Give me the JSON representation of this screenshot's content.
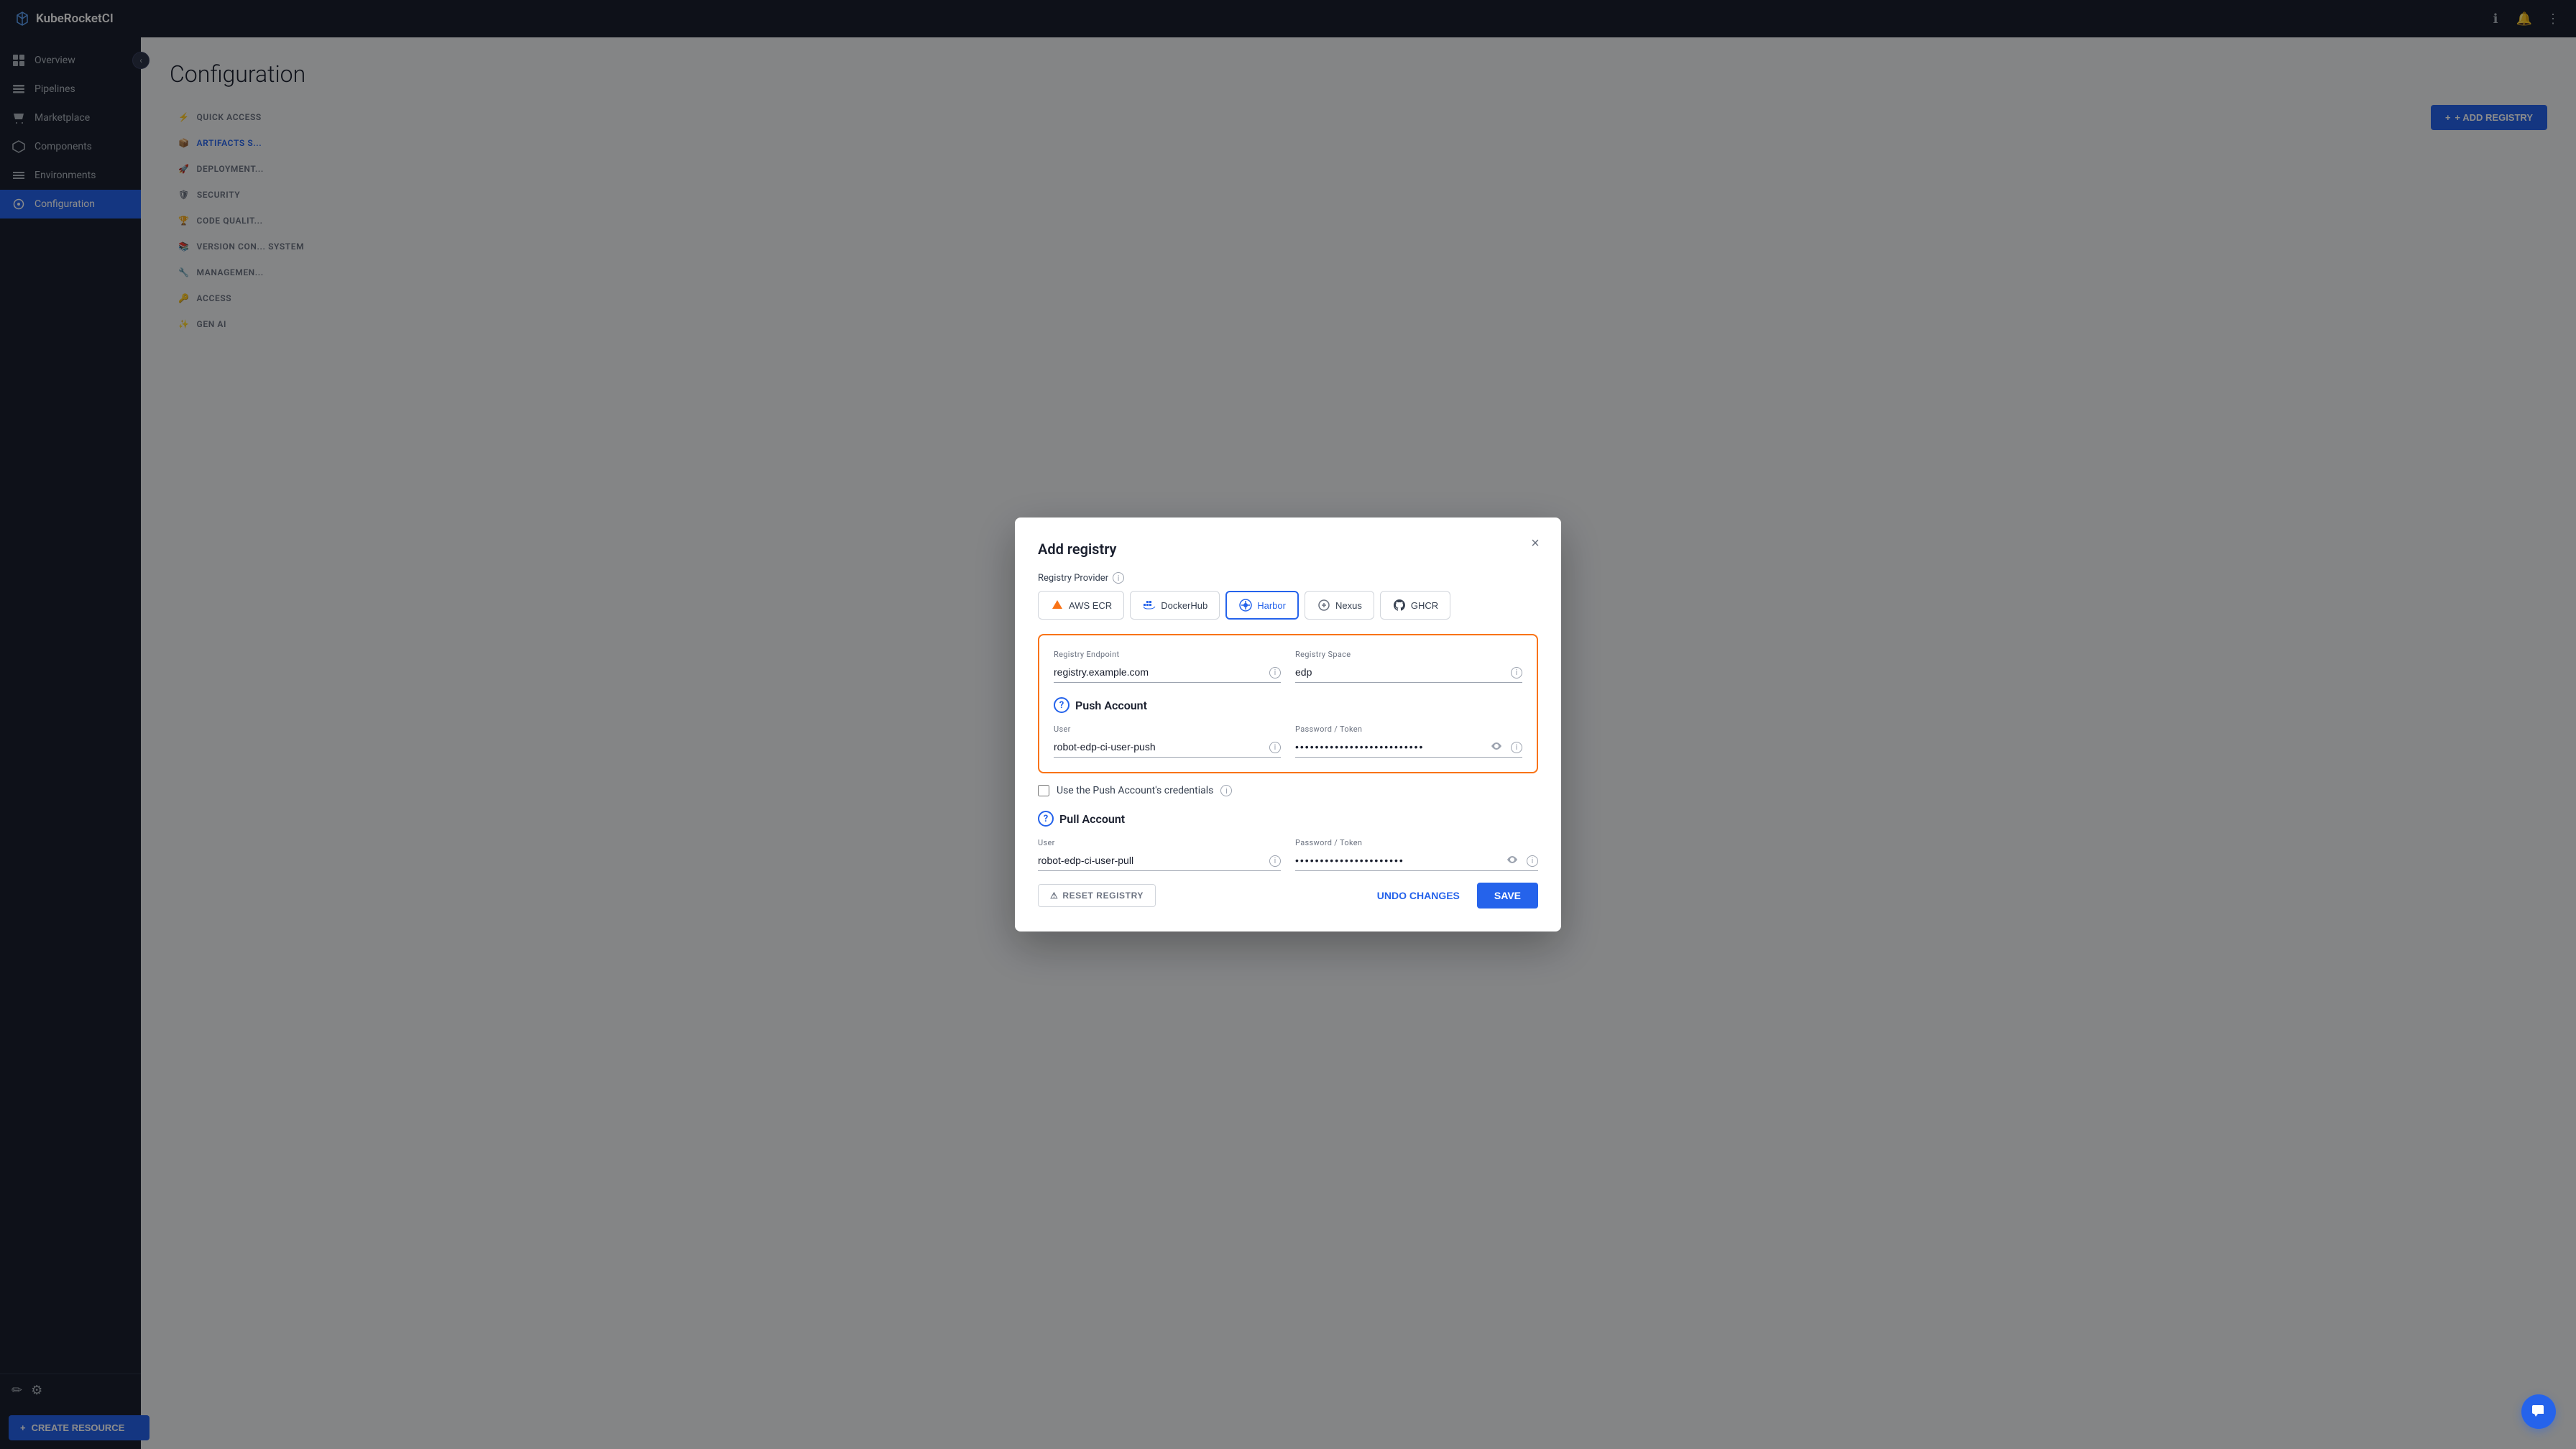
{
  "app": {
    "name": "KubeRocketCI"
  },
  "topbar": {
    "title": "KubeRocketCI",
    "icons": [
      "info",
      "bell",
      "more-vert"
    ]
  },
  "sidebar": {
    "items": [
      {
        "id": "overview",
        "label": "Overview",
        "icon": "grid"
      },
      {
        "id": "pipelines",
        "label": "Pipelines",
        "icon": "film"
      },
      {
        "id": "marketplace",
        "label": "Marketplace",
        "icon": "shopping-cart"
      },
      {
        "id": "components",
        "label": "Components",
        "icon": "layers"
      },
      {
        "id": "environments",
        "label": "Environments",
        "icon": "list"
      },
      {
        "id": "configuration",
        "label": "Configuration",
        "icon": "settings",
        "active": true
      }
    ],
    "bottom_icons": [
      "edit",
      "settings"
    ],
    "create_resource": "CREATE RESOURCE"
  },
  "page": {
    "title": "Configuration"
  },
  "config_nav": [
    {
      "id": "quick-access",
      "label": "QUICK ACCESS",
      "icon": "⚡"
    },
    {
      "id": "artifacts-storage",
      "label": "ARTIFACTS S...",
      "icon": "📦",
      "active": true
    },
    {
      "id": "deployment",
      "label": "DEPLOYMENT...",
      "icon": "🚀"
    },
    {
      "id": "security",
      "label": "SECURITY",
      "icon": "🛡"
    },
    {
      "id": "code-quality",
      "label": "CODE QUALIT...",
      "icon": "🏆"
    },
    {
      "id": "version-control",
      "label": "VERSION CON... SYSTEM",
      "icon": "📚"
    },
    {
      "id": "management",
      "label": "MANAGEMEN...",
      "icon": "🔧"
    },
    {
      "id": "access",
      "label": "ACCESS",
      "icon": "🔑"
    },
    {
      "id": "gen-ai",
      "label": "GEN AI",
      "icon": "✨"
    }
  ],
  "add_registry_button": "+ ADD REGISTRY",
  "modal": {
    "title": "Add registry",
    "registry_provider_label": "Registry Provider",
    "providers": [
      {
        "id": "aws-ecr",
        "label": "AWS ECR",
        "icon": "aws"
      },
      {
        "id": "dockerhub",
        "label": "DockerHub",
        "icon": "docker"
      },
      {
        "id": "harbor",
        "label": "Harbor",
        "icon": "harbor",
        "selected": true
      },
      {
        "id": "nexus",
        "label": "Nexus",
        "icon": "nexus"
      },
      {
        "id": "ghcr",
        "label": "GHCR",
        "icon": "github"
      }
    ],
    "push_account": {
      "title": "Push Account",
      "registry_endpoint_label": "Registry Endpoint",
      "registry_endpoint_value": "registry.example.com",
      "registry_space_label": "Registry Space",
      "registry_space_value": "edp",
      "user_label": "User",
      "user_value": "robot-edp-ci-user-push",
      "password_label": "Password / Token",
      "password_value": "••••••••••••••••••••••••••"
    },
    "use_push_credentials_label": "Use the Push Account's credentials",
    "pull_account": {
      "title": "Pull Account",
      "user_label": "User",
      "user_value": "robot-edp-ci-user-pull",
      "password_label": "Password / Token",
      "password_value": "••••••••••••••••••••••"
    },
    "reset_button": "RESET REGISTRY",
    "undo_button": "UNDO CHANGES",
    "save_button": "SAVE"
  }
}
